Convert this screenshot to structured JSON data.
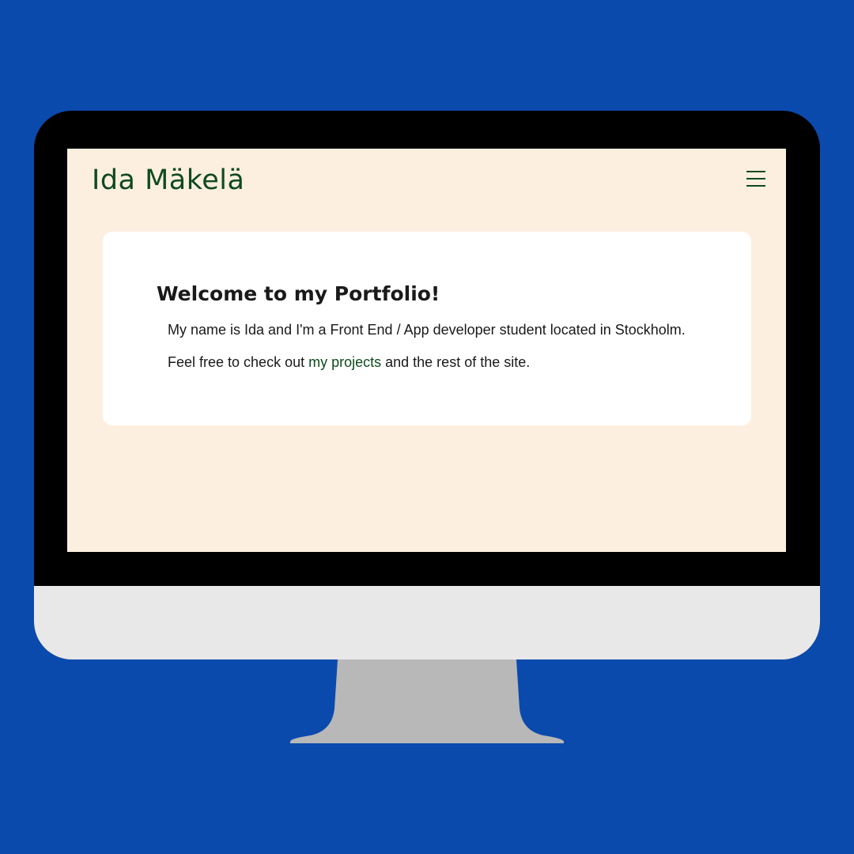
{
  "header": {
    "site_title": "Ida Mäkelä",
    "menu_icon": "hamburger-menu-icon"
  },
  "welcome_card": {
    "heading": "Welcome to my Portfolio!",
    "intro": "My name is Ida and I'm a Front End / App developer student located in Stockholm.",
    "cta_prefix": "Feel free to check out ",
    "cta_link": "my projects",
    "cta_suffix": " and the rest of the site."
  },
  "colors": {
    "backdrop": "#0b4aad",
    "page_background": "#fdefe0",
    "card_background": "#ffffff",
    "brand_green": "#0f4a1c",
    "text": "#1a1a1a",
    "bezel": "#000000",
    "chin": "#e8e8e8",
    "stand": "#b8b8b8"
  }
}
